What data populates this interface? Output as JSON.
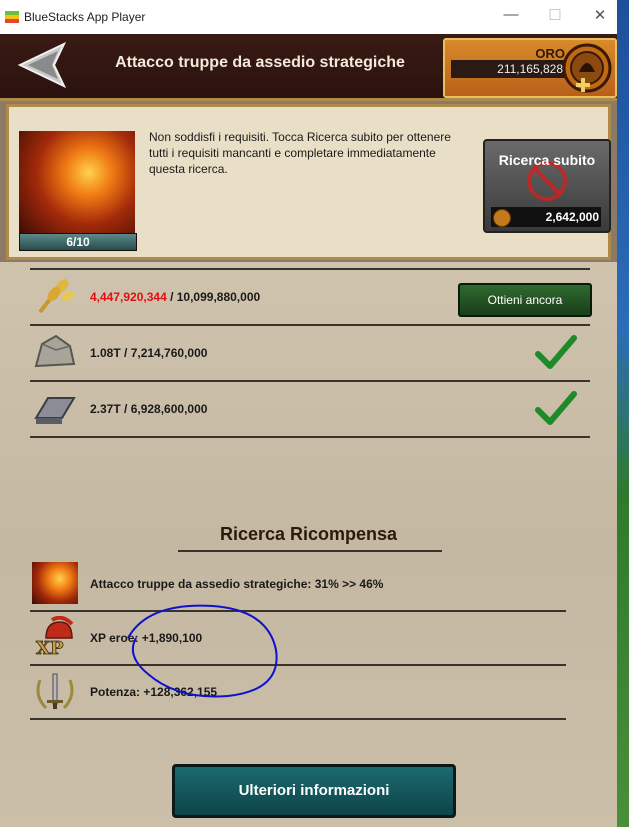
{
  "window": {
    "title": "BlueStacks App Player",
    "controls": [
      "—",
      "☐",
      "✕"
    ]
  },
  "header": {
    "title": "Attacco truppe da assedio strategiche",
    "gold_label": "ORO",
    "gold_value": "211,165,828"
  },
  "info": {
    "level": "6/10",
    "message": "Non soddisfi i requisiti. Tocca Ricerca subito per ottenere tutti i requisiti mancanti e completare immediatamente questa ricerca.",
    "instant_button": "Ricerca subito",
    "instant_cost": "2,642,000"
  },
  "requirements": [
    {
      "icon": "wheat-icon",
      "current": "4,447,920,344",
      "required": " / 10,099,880,000",
      "current_color": "#e01010",
      "action": "Ottieni ancora"
    },
    {
      "icon": "stone-icon",
      "current": "1.08T",
      "required": " / 7,214,760,000",
      "met": true
    },
    {
      "icon": "iron-icon",
      "current": "2.37T",
      "required": " / 6,928,600,000",
      "met": true
    }
  ],
  "rewards": {
    "title": "Ricerca Ricompensa",
    "items": [
      {
        "icon": "research-icon",
        "text": "Attacco truppe da assedio strategiche: 31% >> 46%"
      },
      {
        "icon": "hero-xp-icon",
        "text": "XP eroe: +1,890,100"
      },
      {
        "icon": "power-icon",
        "text": "Potenza: +128,362,155"
      }
    ]
  },
  "more_info_button": "Ulteriori informazioni",
  "colors": {
    "annotation": "#1010d0",
    "header_bg": "#2a120e",
    "button_green": "#2e6a2e",
    "button_teal": "#1a6a70"
  }
}
